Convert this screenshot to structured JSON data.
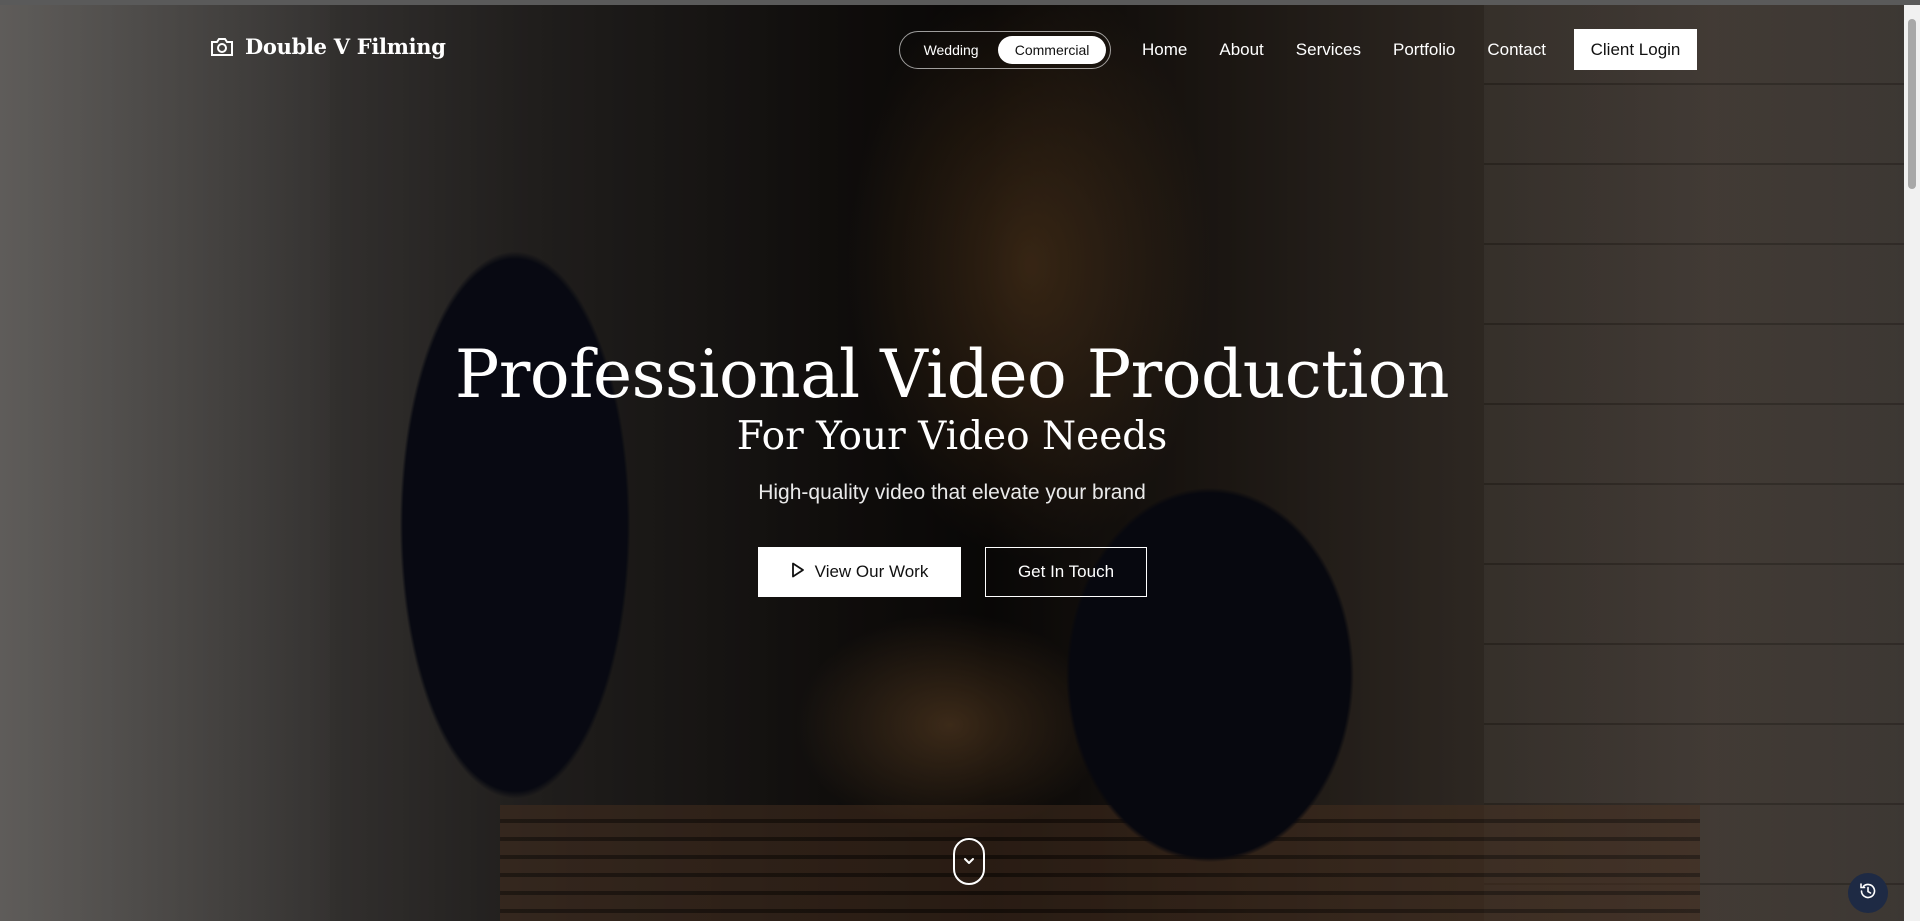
{
  "brand": {
    "name": "Double V Filming",
    "icon": "camera-icon"
  },
  "toggle": {
    "options": [
      "Wedding",
      "Commercial"
    ],
    "selected": "Commercial"
  },
  "nav": {
    "links": [
      "Home",
      "About",
      "Services",
      "Portfolio",
      "Contact"
    ],
    "login_label": "Client Login"
  },
  "hero": {
    "title": "Professional Video Production",
    "subtitle": "For Your Video Needs",
    "tagline": "High-quality video that elevate your brand",
    "primary_button": {
      "label": "View Our Work",
      "icon": "play-icon"
    },
    "secondary_button": {
      "label": "Get In Touch"
    },
    "scroll_icon": "chevron-down-icon"
  },
  "fab": {
    "icon": "history-icon"
  },
  "colors": {
    "accent": "#ffffff",
    "fab_bg": "#1e2a44",
    "overlay": "#000000"
  }
}
